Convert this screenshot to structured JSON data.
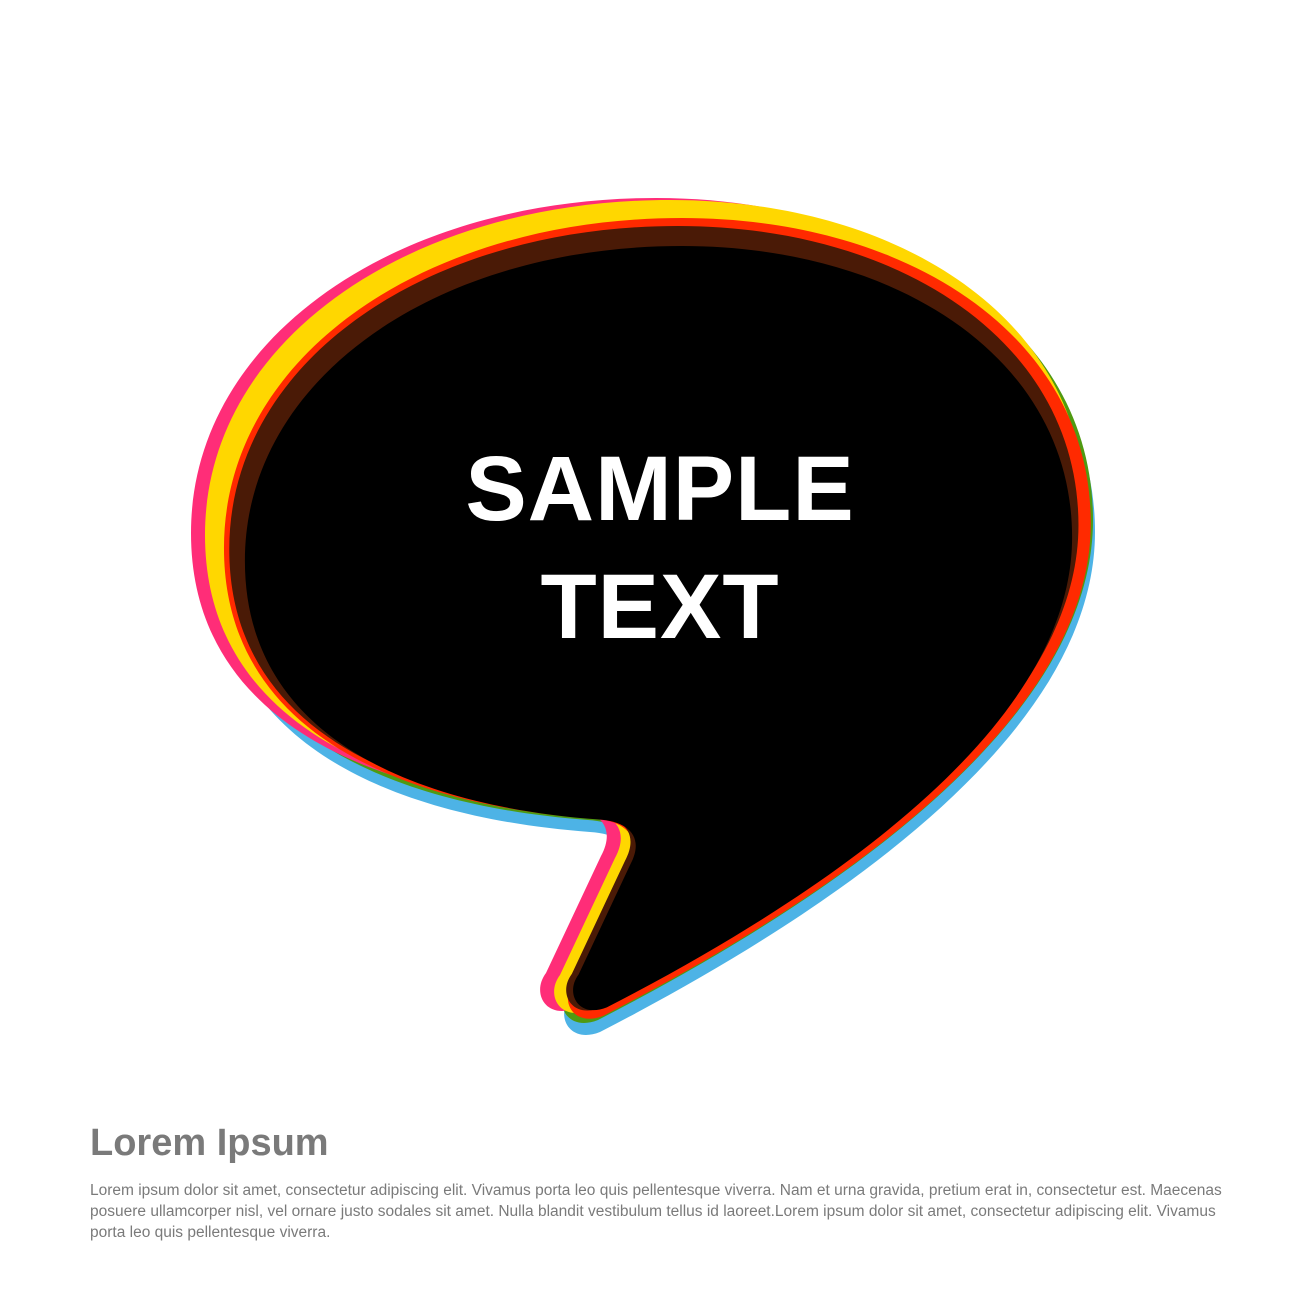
{
  "bubble": {
    "line1": "SAMPLE",
    "line2": "TEXT",
    "colors": {
      "fill": "#000000",
      "yellow": "#FFD700",
      "red": "#FF2A00",
      "green": "#4F9A12",
      "blue": "#4DB3E6",
      "pink": "#FF2D78",
      "text": "#FFFFFF"
    }
  },
  "footer": {
    "title": "Lorem Ipsum",
    "body": "Lorem ipsum dolor sit amet, consectetur adipiscing elit. Vivamus porta leo quis pellentesque viverra. Nam et urna gravida, pretium erat in, consectetur est. Maecenas posuere ullamcorper nisl, vel ornare justo sodales sit amet. Nulla blandit vestibulum tellus id laoreet.Lorem ipsum dolor sit amet, consectetur adipiscing elit. Vivamus porta leo quis pellentesque viverra.",
    "text_color": "#7A7A7A"
  }
}
